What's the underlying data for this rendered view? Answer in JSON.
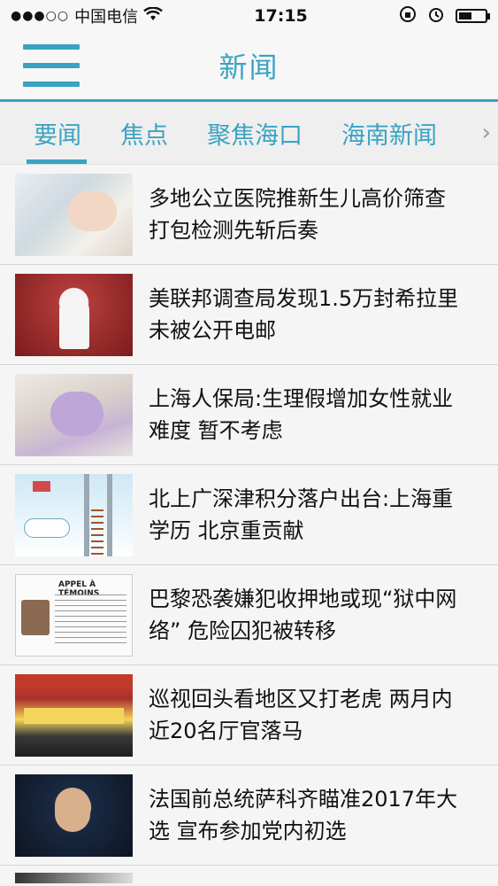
{
  "status_bar": {
    "carrier": "中国电信",
    "signal_dots": "●●●○○",
    "time": "17:15",
    "icons": [
      "wifi-icon",
      "rotation-lock-icon",
      "alarm-icon",
      "battery-icon"
    ]
  },
  "nav": {
    "title": "新闻",
    "menu_icon": "hamburger-menu-icon"
  },
  "tabs": [
    {
      "label": "要闻",
      "active": true
    },
    {
      "label": "焦点",
      "active": false
    },
    {
      "label": "聚焦海口",
      "active": false
    },
    {
      "label": "海南新闻",
      "active": false
    }
  ],
  "tabs_more_icon": "chevron-right-icon",
  "news": [
    {
      "headline": "多地公立医院推新生儿高价筛查 打包检测先斩后奏",
      "thumb": "hospital-newborn-photo"
    },
    {
      "headline": "美联邦调查局发现1.5万封希拉里未被公开电邮",
      "thumb": "politician-rally-photo"
    },
    {
      "headline": "上海人保局:生理假增加女性就业难度 暂不考虑",
      "thumb": "woman-resting-photo"
    },
    {
      "headline": "北上广深津积分落户出台:上海重学历 北京重贡献",
      "thumb": "ladder-illustration"
    },
    {
      "headline": "巴黎恐袭嫌犯收押地或现“狱中网络” 危险囚犯被转移",
      "thumb": "wanted-poster-photo",
      "poster_title": "APPEL À TÉMOINS"
    },
    {
      "headline": "巡视回头看地区又打老虎 两月内近20名厅官落马",
      "thumb": "conference-hall-photo"
    },
    {
      "headline": "法国前总统萨科齐瞄准2017年大选 宣布参加党内初选",
      "thumb": "politician-speech-photo"
    }
  ],
  "colors": {
    "accent": "#3aa3c2",
    "background": "#f2f2f2"
  }
}
